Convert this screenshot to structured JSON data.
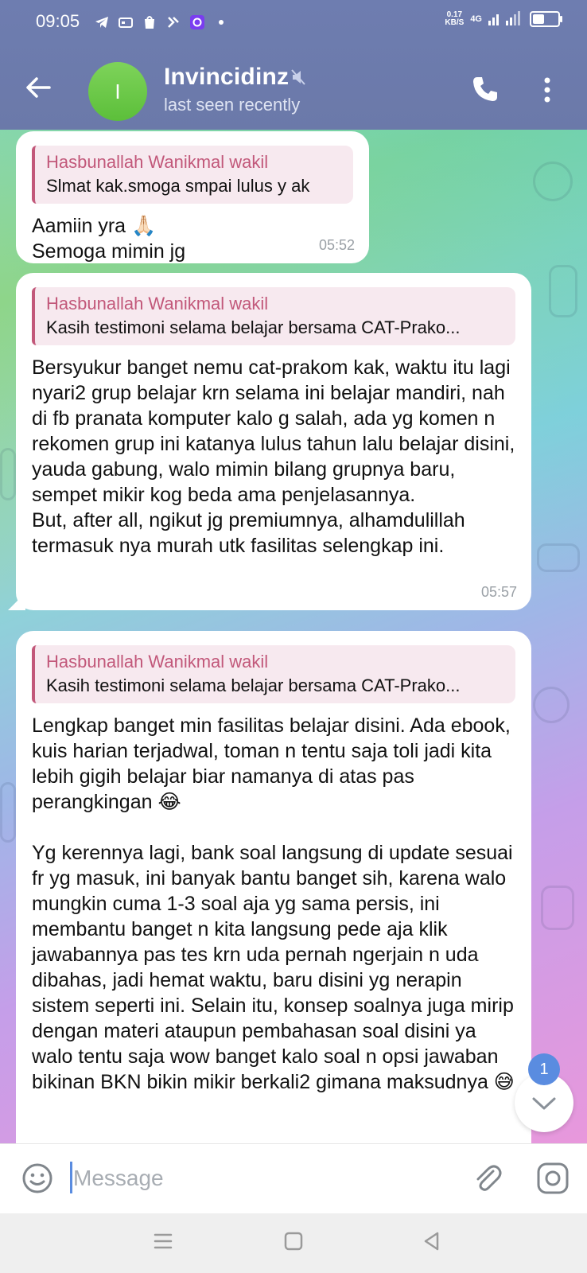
{
  "status_bar": {
    "time": "09:05",
    "net_speed_value": "0.17",
    "net_speed_unit": "KB/S",
    "network": "4G",
    "battery_level": 0.55
  },
  "header": {
    "title": "Invincidinz",
    "subtitle": "last seen recently",
    "avatar_letter": "I"
  },
  "messages": [
    {
      "reply_name": "Hasbunallah Wanikmal wakil",
      "reply_text": "Slmat kak.smoga smpai lulus y ak",
      "text": "Aamiin yra 🙏🏻\nSemoga mimin jg",
      "time": "05:52"
    },
    {
      "reply_name": "Hasbunallah Wanikmal wakil",
      "reply_text": "Kasih testimoni selama belajar bersama CAT-Prako...",
      "text": "Bersyukur banget nemu cat-prakom kak, waktu itu lagi nyari2 grup belajar krn selama ini belajar mandiri, nah di fb pranata komputer kalo g salah, ada yg komen n rekomen grup ini katanya lulus tahun lalu belajar disini, yauda gabung, walo mimin bilang grupnya baru, sempet mikir kog beda ama penjelasannya.\nBut, after all, ngikut jg premiumnya, alhamdulillah termasuk nya murah utk fasilitas selengkap ini.",
      "time": "05:57"
    },
    {
      "reply_name": "Hasbunallah Wanikmal wakil",
      "reply_text": "Kasih testimoni selama belajar bersama CAT-Prako...",
      "text": "Lengkap banget min fasilitas belajar disini. Ada ebook, kuis harian terjadwal, toman n tentu saja toli jadi kita lebih gigih belajar biar namanya di atas pas perangkingan 😂\n\nYg kerennya lagi, bank soal langsung di update sesuai fr yg masuk, ini banyak bantu banget sih, karena walo mungkin cuma 1-3 soal aja yg sama persis, ini membantu banget n kita langsung pede aja klik jawabannya pas tes krn uda pernah ngerjain n uda dibahas, jadi hemat waktu, baru disini yg nerapin sistem seperti ini. Selain itu, konsep soalnya juga mirip dengan materi ataupun pembahasan soal disini ya walo tentu saja wow banget kalo soal n opsi jawaban bikinan BKN bikin mikir berkali2 gimana maksudnya 😅"
    }
  ],
  "scroll_badge": "1",
  "composer": {
    "placeholder": "Message"
  },
  "icons": {
    "back": "arrow-left-icon",
    "mute": "muted-speaker-icon",
    "call": "phone-icon",
    "more": "more-vertical-icon",
    "emoji": "emoji-icon",
    "attach": "paperclip-icon",
    "camera": "instagram-camera-icon",
    "scroll_down": "chevron-down-icon"
  },
  "colors": {
    "header_bg": "#6e7db0",
    "reply_accent": "#c2587a",
    "badge": "#5a8ce0"
  }
}
